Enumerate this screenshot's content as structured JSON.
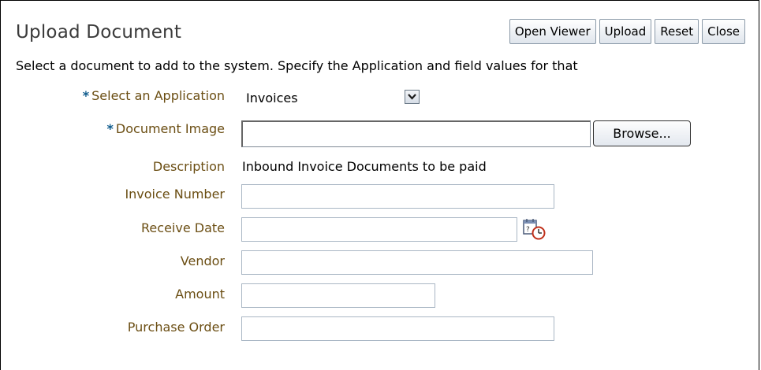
{
  "page": {
    "title": "Upload Document",
    "instructions": "Select a document to add to the system. Specify the Application and field values for that"
  },
  "toolbar": {
    "open_viewer": "Open Viewer",
    "upload": "Upload",
    "reset": "Reset",
    "close": "Close"
  },
  "form": {
    "required_marker": "*",
    "application": {
      "label": "Select an Application",
      "value": "Invoices"
    },
    "document_image": {
      "label": "Document Image",
      "value": "",
      "browse": "Browse..."
    },
    "description": {
      "label": "Description",
      "value": "Inbound Invoice Documents to be paid"
    },
    "invoice_number": {
      "label": "Invoice Number",
      "value": ""
    },
    "receive_date": {
      "label": "Receive Date",
      "value": "",
      "icon": "calendar-clock-icon"
    },
    "vendor": {
      "label": "Vendor",
      "value": ""
    },
    "amount": {
      "label": "Amount",
      "value": ""
    },
    "purchase_order": {
      "label": "Purchase Order",
      "value": ""
    }
  }
}
